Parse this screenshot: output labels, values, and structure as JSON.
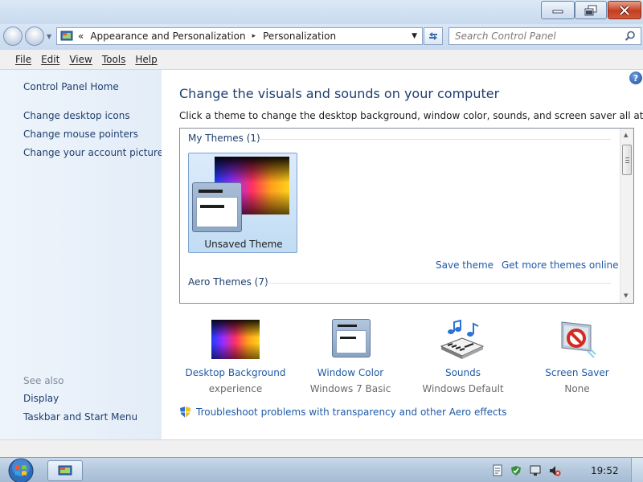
{
  "window": {
    "caption_buttons": {
      "minimize": "minimize-icon",
      "restore": "restore-icon",
      "close": "close-icon"
    }
  },
  "address_bar": {
    "chevron": "«",
    "segments": [
      "Appearance and Personalization",
      "Personalization"
    ],
    "separator": "▸",
    "search_placeholder": "Search Control Panel"
  },
  "menu": [
    "File",
    "Edit",
    "View",
    "Tools",
    "Help"
  ],
  "left_pane": {
    "home": "Control Panel Home",
    "links": [
      "Change desktop icons",
      "Change mouse pointers",
      "Change your account picture"
    ],
    "see_also_label": "See also",
    "see_also": [
      "Display",
      "Taskbar and Start Menu"
    ]
  },
  "main": {
    "help_label": "?",
    "title": "Change the visuals and sounds on your computer",
    "subtitle": "Click a theme to change the desktop background, window color, sounds, and screen saver all at once.",
    "groups": [
      {
        "label": "My Themes (1)"
      },
      {
        "label": "Aero Themes (7)"
      }
    ],
    "selected_theme": "Unsaved Theme",
    "save_theme": "Save theme",
    "get_more": "Get more themes online",
    "settings": [
      {
        "name": "Desktop Background",
        "value": "experience"
      },
      {
        "name": "Window Color",
        "value": "Windows 7 Basic"
      },
      {
        "name": "Sounds",
        "value": "Windows Default"
      },
      {
        "name": "Screen Saver",
        "value": "None"
      }
    ],
    "troubleshoot": "Troubleshoot problems with transparency and other Aero effects"
  },
  "taskbar": {
    "clock": "19:52"
  },
  "colors": {
    "link": "#1f5ba8",
    "heading": "#1e3f6f",
    "left_pane": "#e9f1fa",
    "close_button": "#c43d20"
  }
}
